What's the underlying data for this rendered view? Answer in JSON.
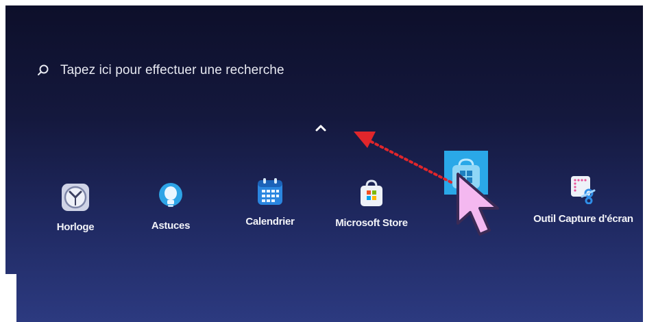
{
  "search": {
    "placeholder": "Tapez ici pour effectuer une recherche",
    "icon": "search-icon"
  },
  "expand": {
    "icon": "chevron-up-icon"
  },
  "apps": [
    {
      "label": "Horloge",
      "icon": "clock-icon"
    },
    {
      "label": "Astuces",
      "icon": "lightbulb-icon"
    },
    {
      "label": "Calendrier",
      "icon": "calendar-icon"
    },
    {
      "label": "Microsoft Store",
      "icon": "store-bag-icon"
    },
    {
      "label": "",
      "icon": "dragged-store-icon"
    },
    {
      "label": "Outil Capture d'écran",
      "icon": "snipping-tool-icon"
    }
  ],
  "annotation": {
    "arrow_color": "#e0262b",
    "cursor_color": "#f4b8f0"
  },
  "colors": {
    "accent_blue": "#2aa8e8",
    "text": "#e8eaf2",
    "background": "#14183d"
  }
}
